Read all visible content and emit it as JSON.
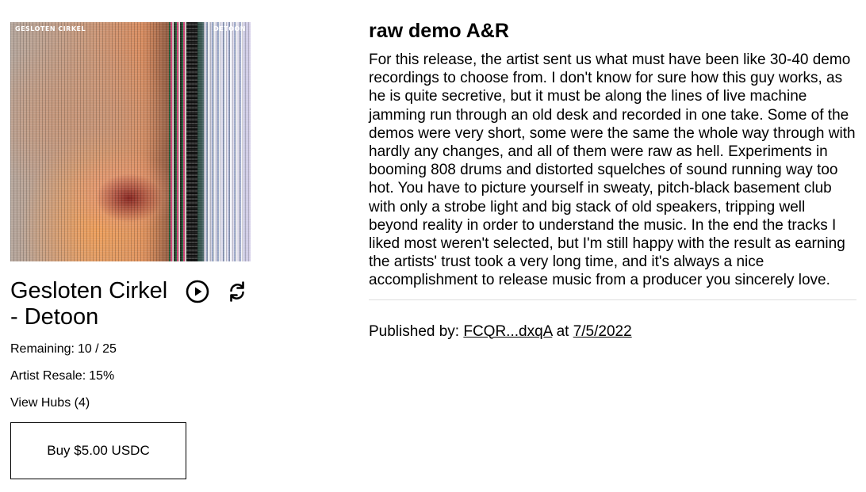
{
  "release": {
    "cover_label_left": "GESLOTEN CIRKEL",
    "cover_label_right": "DETOON",
    "title": "Gesloten Cirkel - Detoon",
    "remaining_label": "Remaining:",
    "remaining_value": "10 / 25",
    "artist_resale_label": "Artist Resale:",
    "artist_resale_value": "15%",
    "view_hubs_label": "View Hubs (4)",
    "buy_label": "Buy $5.00 USDC"
  },
  "description": {
    "heading": "raw demo A&R",
    "body": "For this release, the artist sent us what must have been like 30-40 demo recordings to choose from. I don't know for sure how this guy works, as he is quite secretive, but it must be along the lines of live machine jamming run through an old desk and recorded in one take. Some of the demos were very short, some were the same the whole way through with hardly any changes, and all of them were raw as hell. Experiments in booming 808 drums and distorted squelches of sound running way too hot. You have to picture yourself in sweaty, pitch-black basement club with only a strobe light and big stack of old speakers, tripping well beyond reality in order to understand the music. In the end the tracks I liked most weren't selected, but I'm still happy with the result as earning the artists' trust took a very long time, and it's always a nice accomplishment to release music from a producer you sincerely love."
  },
  "published": {
    "prefix": "Published by:",
    "publisher": "FCQR...dxqA",
    "at_word": "at",
    "date": "7/5/2022"
  },
  "icons": {
    "play": "play-circle-icon",
    "repost": "repost-icon"
  }
}
